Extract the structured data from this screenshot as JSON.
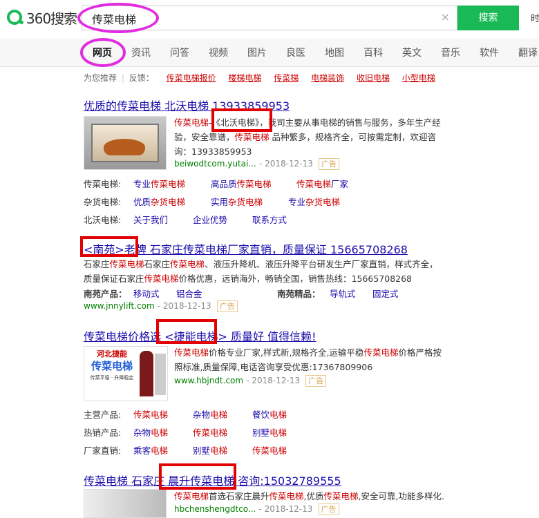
{
  "logo": {
    "text": "360搜索"
  },
  "search": {
    "query": "传菜电梯",
    "clear_icon": "×",
    "button": "搜索",
    "right_cut": "时"
  },
  "nav": {
    "items": [
      "网页",
      "资讯",
      "问答",
      "视频",
      "图片",
      "良医",
      "地图",
      "百科",
      "英文",
      "音乐",
      "软件",
      "翻译"
    ],
    "active": "网页"
  },
  "recommend": {
    "prefix": "为您推荐",
    "sep": "|",
    "feedback": "反馈：",
    "items": [
      "传菜电梯报价",
      "楼梯电梯",
      "传菜梯",
      "电梯装饰",
      "收旧电梯",
      "小型电梯"
    ]
  },
  "results": [
    {
      "title_a": "优质的传菜电梯 北沃电梯 13933859953",
      "desc_l1": "传菜电梯-《北沃电梯》，我司主要从事电梯的销售与服务，多年生产经",
      "desc_l2": "验，安全靠谱，传菜电梯 品种繁多，规格齐全，可按需定制，欢迎咨",
      "desc_l3": "询：13933859953",
      "url": "beiwodtcom.yutai...",
      "date": "- 2018-12-13",
      "ad": "广告",
      "rows": [
        {
          "label": "传菜电梯:",
          "links": [
            "专业传菜电梯",
            "高品质传菜电梯",
            "传菜电梯厂家"
          ]
        },
        {
          "label": "杂货电梯:",
          "links": [
            "优质杂货电梯",
            "实用杂货电梯",
            "专业杂货电梯"
          ]
        },
        {
          "label": "北沃电梯:",
          "links": [
            "关于我们",
            "企业优势",
            "联系方式"
          ]
        }
      ]
    },
    {
      "title": "<南苑>老牌 石家庄传菜电梯厂家直销，质量保证 15665708268",
      "desc_l1": "石家庄传菜电梯石家庄传菜电梯、液压升降机、液压升降平台研发生产厂家直销，样式齐全，",
      "desc_l2": "质量保证石家庄传菜电梯价格优惠，远销海外，畅销全国，销售热线：15665708268",
      "prod_label": "南苑产品：",
      "prod_links": [
        "移动式",
        "铝合金"
      ],
      "fine_label": "南苑精品：",
      "fine_links": [
        "导轨式",
        "固定式"
      ],
      "url": "www.jnnylift.com",
      "date": "- 2018-12-13",
      "ad": "广告"
    },
    {
      "title": "传菜电梯价格选 <捷能电梯> 质量好 值得信赖!",
      "desc_l1": "传菜电梯价格专业厂家,样式新,规格齐全,运输平稳传菜电梯价格严格按",
      "desc_l2": "照标准,质量保障,电话咨询享受优惠:17367809906",
      "url": "www.hbjndt.com",
      "date": "- 2018-12-13",
      "ad": "广告",
      "thumb_l1": "河北捷能",
      "thumb_l2": "传菜电梯",
      "thumb_l3": "传菜平稳 · 升降稳定",
      "rows": [
        {
          "label": "主营产品:",
          "links": [
            "传菜电梯",
            "杂物电梯",
            "餐饮电梯"
          ]
        },
        {
          "label": "热销产品:",
          "links": [
            "杂物电梯",
            "传菜电梯",
            "别墅电梯"
          ]
        },
        {
          "label": "厂家直销:",
          "links": [
            "乘客电梯",
            "别墅电梯",
            "传菜电梯"
          ]
        }
      ]
    },
    {
      "title": "传菜电梯 石家庄 晨升传菜电梯 咨询:15032789555",
      "desc_l1": "传菜电梯首选石家庄晨升传菜电梯,优质传菜电梯,安全可靠,功能多样化.",
      "url": "hbchenshengdtco...",
      "date": "- 2018-12-13",
      "ad": "广告"
    }
  ],
  "colors": {
    "brand": "#19b955",
    "highlight": "#e22ae0",
    "box": "#e30000",
    "link": "#1a0dab",
    "red": "#cc0000"
  }
}
